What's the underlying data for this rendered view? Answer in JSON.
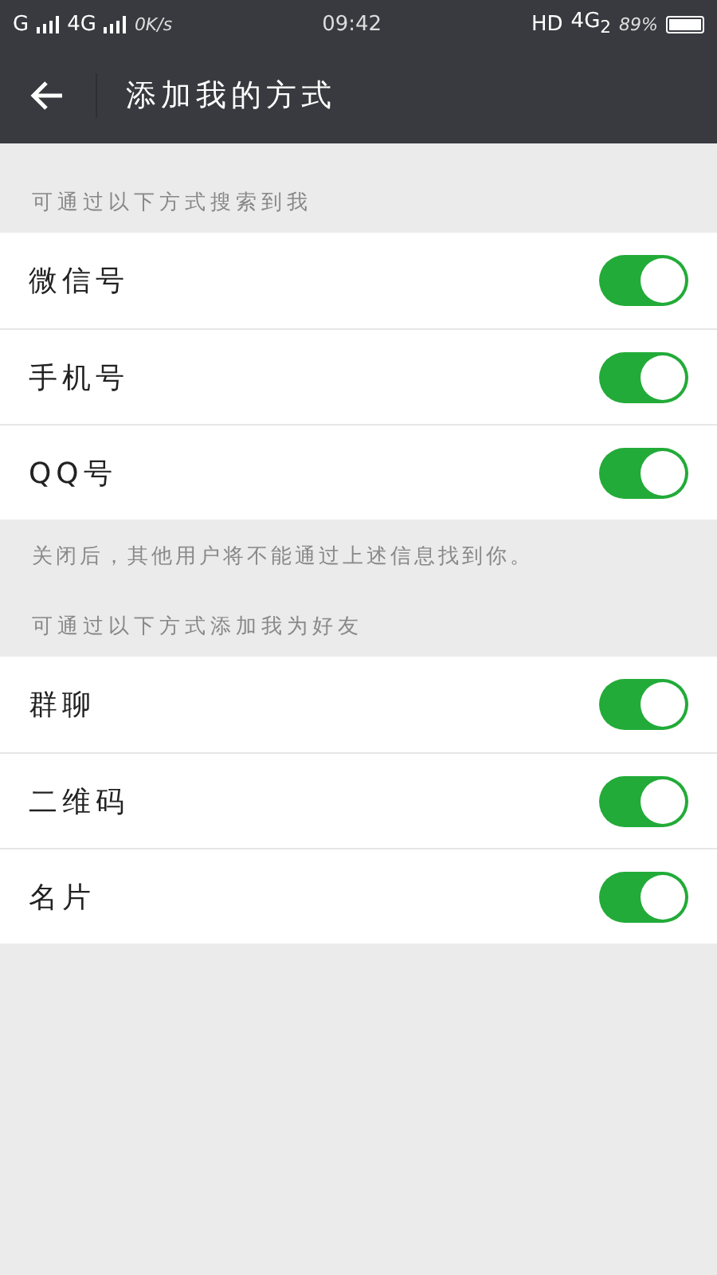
{
  "status_bar": {
    "sim1": "G",
    "sim2": "4G",
    "speed": "0K/s",
    "time": "09:42",
    "hd": "HD",
    "network": "4G$_{2}$",
    "battery": "89%"
  },
  "header": {
    "title": "添加我的方式"
  },
  "sections": [
    {
      "title": "可通过以下方式搜索到我",
      "items": [
        {
          "label": "微信号",
          "on": true
        },
        {
          "label": "手机号",
          "on": true
        },
        {
          "label": "QQ号",
          "on": true
        }
      ],
      "note": "关闭后，其他用户将不能通过上述信息找到你。"
    },
    {
      "title": "可通过以下方式添加我为好友",
      "items": [
        {
          "label": "群聊",
          "on": true
        },
        {
          "label": "二维码",
          "on": true
        },
        {
          "label": "名片",
          "on": true
        }
      ]
    }
  ]
}
